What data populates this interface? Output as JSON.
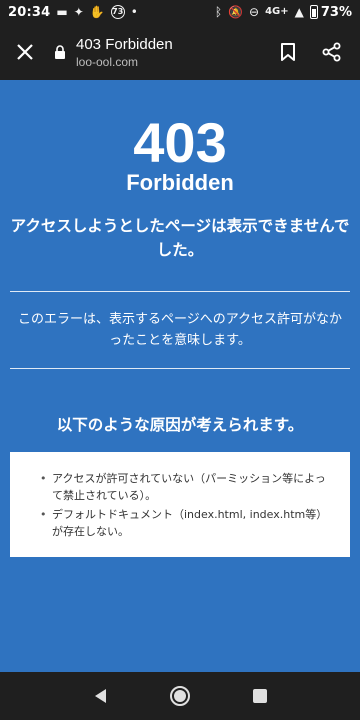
{
  "status_bar": {
    "time": "20:34",
    "notification_badge": "73",
    "network": "4G+",
    "battery": "73%"
  },
  "browser": {
    "page_title": "403 Forbidden",
    "url": "loo-ool.com"
  },
  "page": {
    "code": "403",
    "code_text": "Forbidden",
    "lead": "アクセスしようとしたページは表示できませんでした。",
    "explain": "このエラーは、表示するページへのアクセス許可がなかったことを意味します。",
    "causes_title": "以下のような原因が考えられます。",
    "causes": [
      "アクセスが許可されていない（パーミッション等によって禁止されている）。",
      "デフォルトドキュメント（index.html, index.htm等）が存在しない。"
    ]
  },
  "colors": {
    "background": "#2f73c0",
    "bars": "#1f1f1f"
  },
  "icons": {
    "close": "close-icon",
    "lock": "lock-icon",
    "bookmark": "bookmark-icon",
    "share": "share-icon",
    "back": "back-icon",
    "home": "home-icon",
    "recents": "recents-icon"
  }
}
